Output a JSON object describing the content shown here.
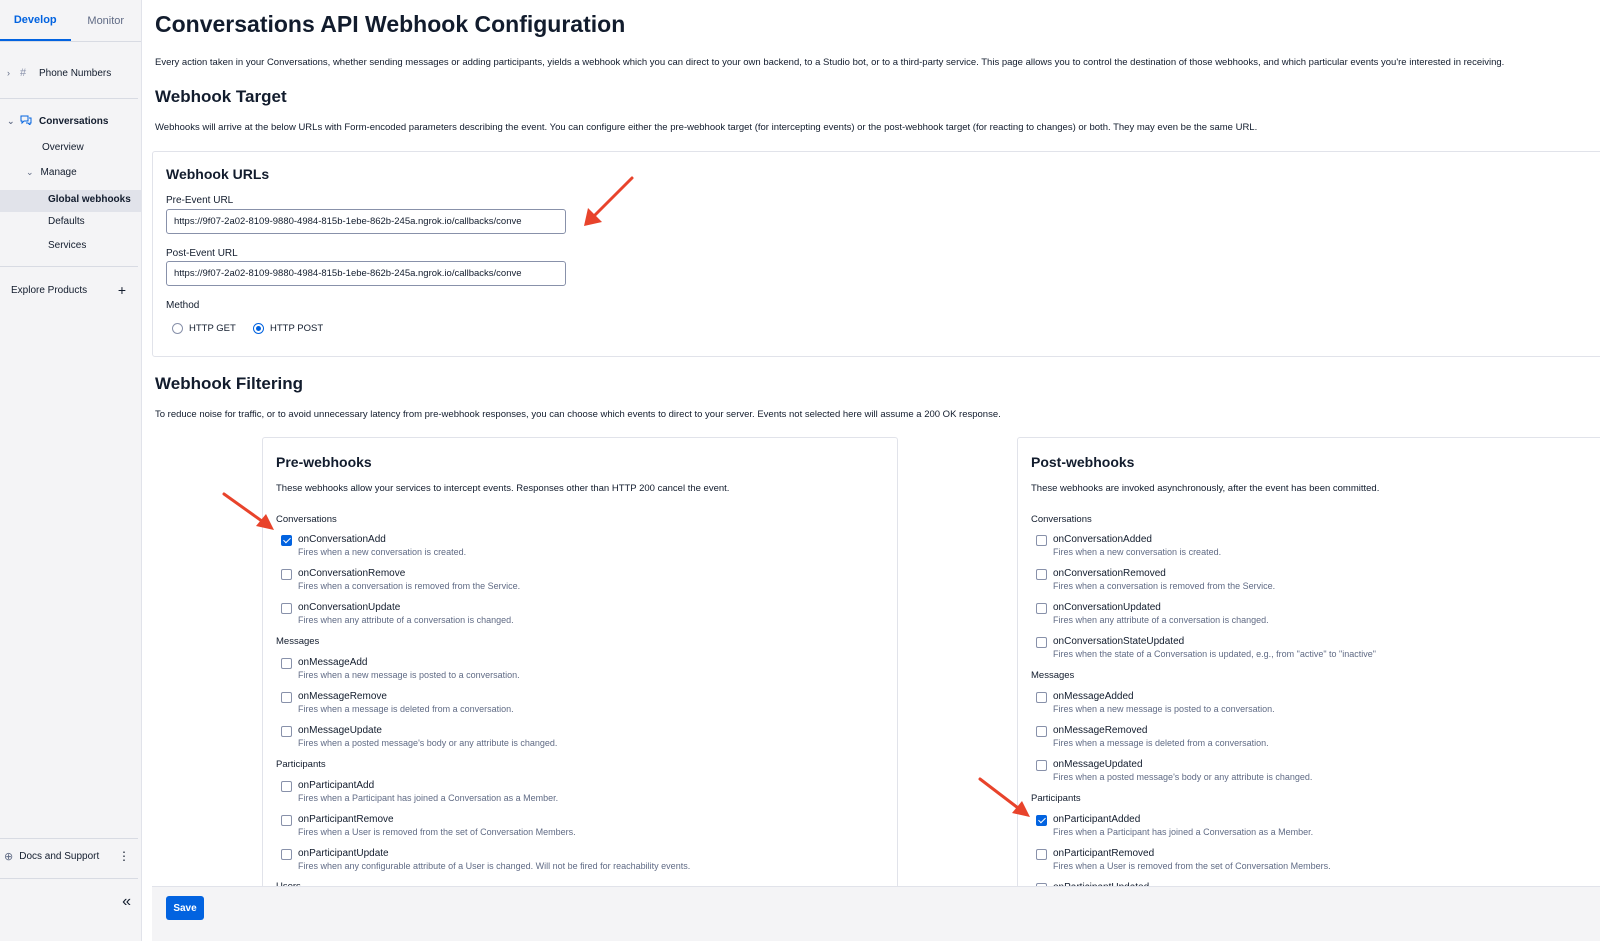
{
  "sidebar": {
    "tabs": [
      "Develop",
      "Monitor"
    ],
    "phone_numbers": "Phone Numbers",
    "conversations": "Conversations",
    "overview": "Overview",
    "manage": "Manage",
    "global_webhooks": "Global webhooks",
    "defaults": "Defaults",
    "services": "Services",
    "explore_products": "Explore Products",
    "docs_support": "Docs and Support"
  },
  "page": {
    "title": "Conversations API Webhook Configuration",
    "intro": "Every action taken in your Conversations, whether sending messages or adding participants, yields a webhook which you can direct to your own backend, to a Studio bot, or to a third-party service. This page allows you to control the destination of those webhooks, and which particular events you're interested in receiving.",
    "target_heading": "Webhook Target",
    "target_desc": "Webhooks will arrive at the below URLs with Form-encoded parameters describing the event. You can configure either the pre-webhook target (for intercepting events) or the post-webhook target (for reacting to changes) or both. They may even be the same URL.",
    "filtering_heading": "Webhook Filtering",
    "filtering_desc": "To reduce noise for traffic, or to avoid unnecessary latency from pre-webhook responses, you can choose which events to direct to your server. Events not selected here will assume a 200 OK response."
  },
  "urls": {
    "title": "Webhook URLs",
    "pre_label": "Pre-Event URL",
    "pre_value": "https://9f07-2a02-8109-9880-4984-815b-1ebe-862b-245a.ngrok.io/callbacks/conve",
    "post_label": "Post-Event URL",
    "post_value": "https://9f07-2a02-8109-9880-4984-815b-1ebe-862b-245a.ngrok.io/callbacks/conve",
    "method_label": "Method",
    "method_get": "HTTP GET",
    "method_post": "HTTP POST",
    "selected_method": "HTTP POST"
  },
  "pre_webhooks": {
    "title": "Pre-webhooks",
    "desc": "These webhooks allow your services to intercept events. Responses other than HTTP 200 cancel the event.",
    "groups": {
      "conversations": "Conversations",
      "messages": "Messages",
      "participants": "Participants",
      "users": "Users"
    },
    "events": [
      {
        "name": "onConversationAdd",
        "desc": "Fires when a new conversation is created.",
        "checked": true
      },
      {
        "name": "onConversationRemove",
        "desc": "Fires when a conversation is removed from the Service.",
        "checked": false
      },
      {
        "name": "onConversationUpdate",
        "desc": "Fires when any attribute of a conversation is changed.",
        "checked": false
      },
      {
        "name": "onMessageAdd",
        "desc": "Fires when a new message is posted to a conversation.",
        "checked": false
      },
      {
        "name": "onMessageRemove",
        "desc": "Fires when a message is deleted from a conversation.",
        "checked": false
      },
      {
        "name": "onMessageUpdate",
        "desc": "Fires when a posted message's body or any attribute is changed.",
        "checked": false
      },
      {
        "name": "onParticipantAdd",
        "desc": "Fires when a Participant has joined a Conversation as a Member.",
        "checked": false
      },
      {
        "name": "onParticipantRemove",
        "desc": "Fires when a User is removed from the set of Conversation Members.",
        "checked": false
      },
      {
        "name": "onParticipantUpdate",
        "desc": "Fires when any configurable attribute of a User is changed. Will not be fired for reachability events.",
        "checked": false
      }
    ]
  },
  "post_webhooks": {
    "title": "Post-webhooks",
    "desc": "These webhooks are invoked asynchronously, after the event has been committed.",
    "groups": {
      "conversations": "Conversations",
      "messages": "Messages",
      "participants": "Participants"
    },
    "events": [
      {
        "name": "onConversationAdded",
        "desc": "Fires when a new conversation is created.",
        "checked": false
      },
      {
        "name": "onConversationRemoved",
        "desc": "Fires when a conversation is removed from the Service.",
        "checked": false
      },
      {
        "name": "onConversationUpdated",
        "desc": "Fires when any attribute of a conversation is changed.",
        "checked": false
      },
      {
        "name": "onConversationStateUpdated",
        "desc": "Fires when the state of a Conversation is updated, e.g., from \"active\" to \"inactive\"",
        "checked": false
      },
      {
        "name": "onMessageAdded",
        "desc": "Fires when a new message is posted to a conversation.",
        "checked": false
      },
      {
        "name": "onMessageRemoved",
        "desc": "Fires when a message is deleted from a conversation.",
        "checked": false
      },
      {
        "name": "onMessageUpdated",
        "desc": "Fires when a posted message's body or any attribute is changed.",
        "checked": false
      },
      {
        "name": "onParticipantAdded",
        "desc": "Fires when a Participant has joined a Conversation as a Member.",
        "checked": true
      },
      {
        "name": "onParticipantRemoved",
        "desc": "Fires when a User is removed from the set of Conversation Members.",
        "checked": false
      },
      {
        "name": "onParticipantUpdated",
        "desc": "",
        "checked": false
      }
    ]
  },
  "footer": {
    "save_label": "Save"
  },
  "colors": {
    "accent": "#0263e0",
    "annotation_arrow": "#e8432b"
  }
}
